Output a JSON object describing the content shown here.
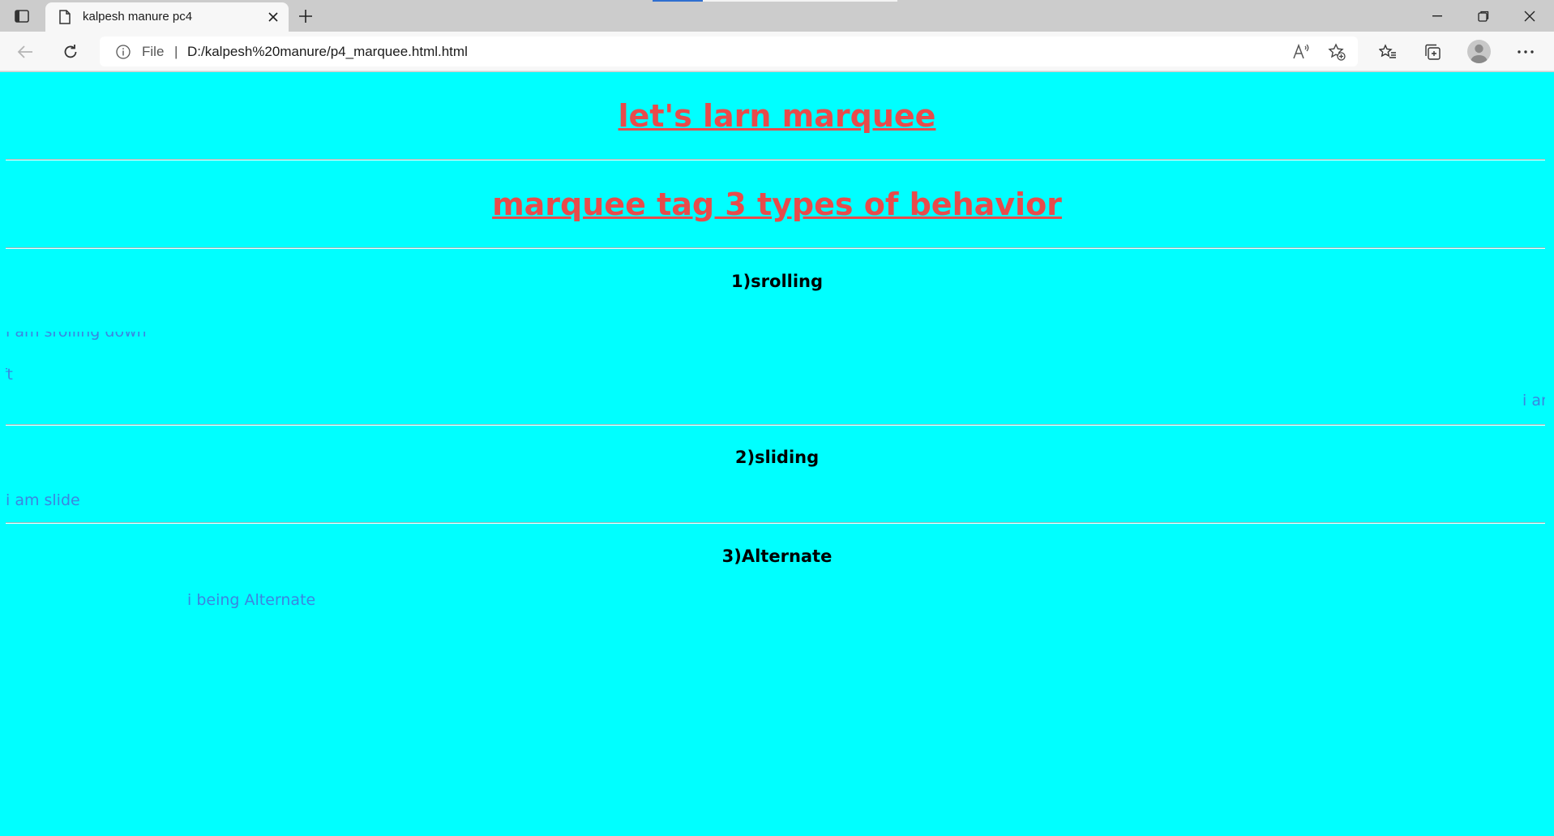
{
  "browser": {
    "tab_title": "kalpesh manure pc4",
    "address_scheme": "File",
    "address_separator": "|",
    "url": "D:/kalpesh%20manure/p4_marquee.html.html"
  },
  "page": {
    "heading": "let's larn marquee",
    "subheading": "marquee tag 3 types of behavior",
    "sections": [
      {
        "title": "1)srolling"
      },
      {
        "title": "2)sliding"
      },
      {
        "title": "3)Alternate"
      }
    ],
    "marquees": {
      "scroll_down": "i am srolling down",
      "scroll_left_fragment": "ft",
      "scroll_right_fragment": "i am",
      "slide": "i am slide",
      "alternate": "i being Alternate"
    },
    "colors": {
      "background": "#00ffff",
      "heading": "#e84b4b",
      "marquee_text": "#3a86e0"
    }
  }
}
